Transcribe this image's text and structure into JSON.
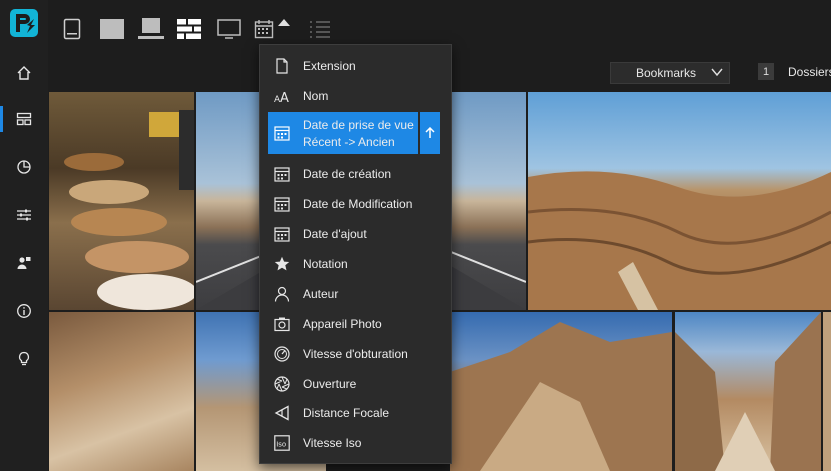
{
  "toolbar": {
    "bookmarks_label": "Bookmarks",
    "folders_count": "1",
    "folders_label": "Dossiers"
  },
  "sort_menu": {
    "items": [
      {
        "label": "Extension",
        "icon": "file-icon"
      },
      {
        "label": "Nom",
        "icon": "font-size-icon"
      },
      {
        "label": "Date de prise de vue",
        "sublabel": "Récent -> Ancien",
        "icon": "calendar-icon",
        "selected": true
      },
      {
        "label": "Date de création",
        "icon": "calendar-icon"
      },
      {
        "label": "Date de Modification",
        "icon": "calendar-icon"
      },
      {
        "label": "Date d'ajout",
        "icon": "calendar-icon"
      },
      {
        "label": "Notation",
        "icon": "star-icon"
      },
      {
        "label": "Auteur",
        "icon": "person-icon"
      },
      {
        "label": "Appareil Photo",
        "icon": "camera-icon"
      },
      {
        "label": "Vitesse d'obturation",
        "icon": "shutter-speed-icon"
      },
      {
        "label": "Ouverture",
        "icon": "aperture-icon"
      },
      {
        "label": "Distance Focale",
        "icon": "focal-length-icon"
      },
      {
        "label": "Vitesse Iso",
        "icon": "iso-icon"
      }
    ]
  },
  "colors": {
    "accent": "#1e88e5",
    "background": "#1d1d1d",
    "menu_bg": "#2b2b2b"
  }
}
